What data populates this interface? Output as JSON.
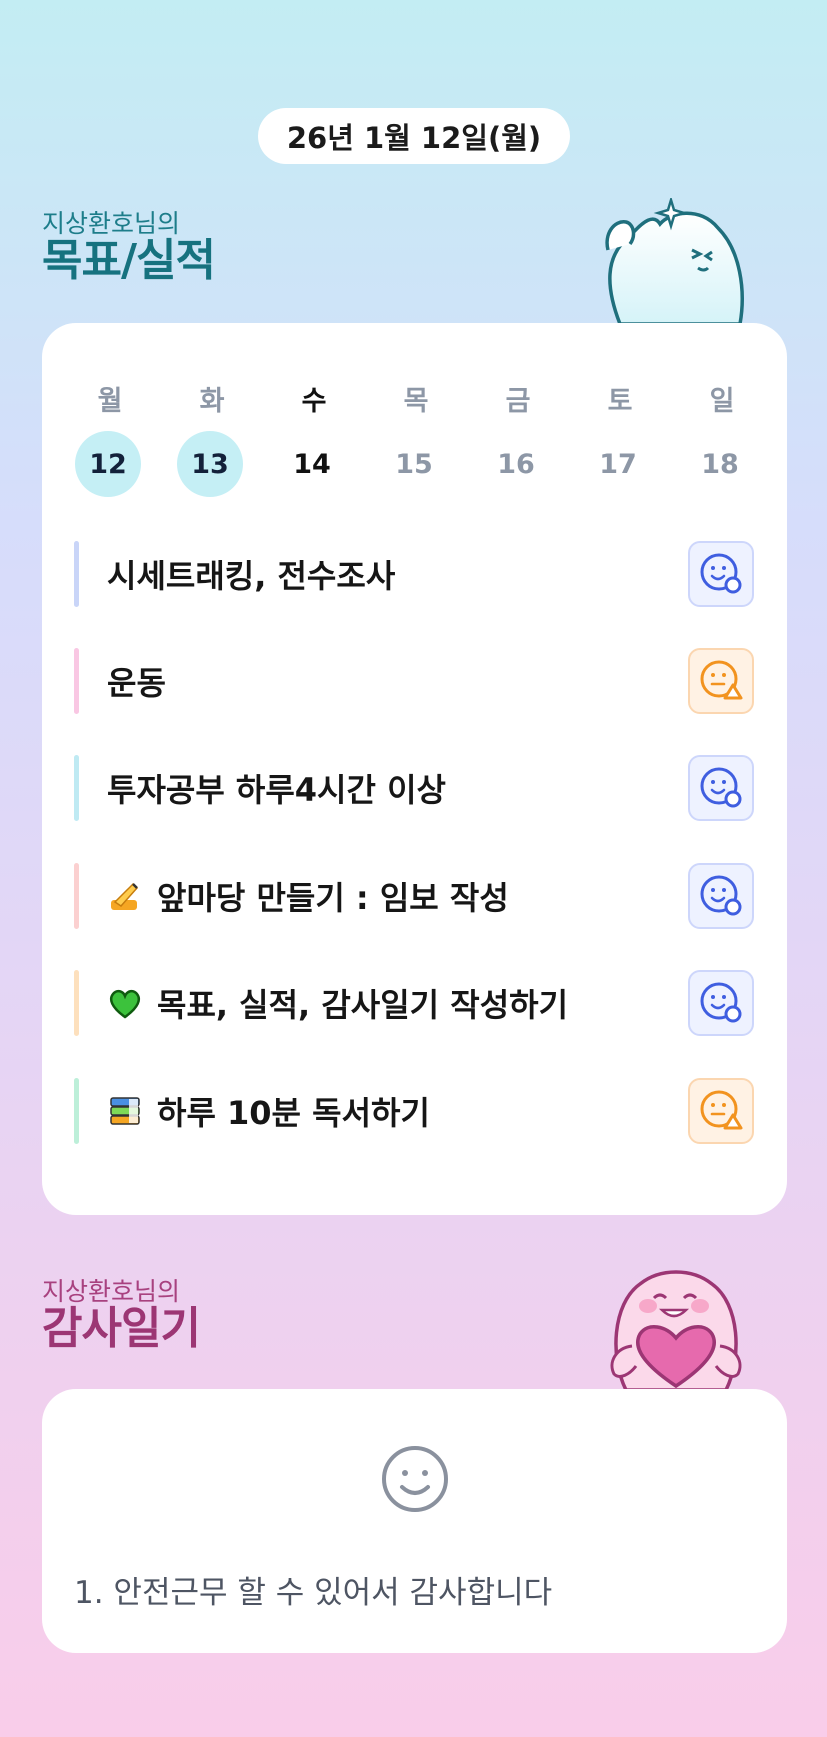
{
  "header": {
    "date": "26년 1월 12일(월)"
  },
  "goals_section": {
    "owner": "지상환호님의",
    "title": "목표/실적"
  },
  "week": {
    "days": [
      {
        "dow": "월",
        "num": "12",
        "state": "done"
      },
      {
        "dow": "화",
        "num": "13",
        "state": "done"
      },
      {
        "dow": "수",
        "num": "14",
        "state": "today"
      },
      {
        "dow": "목",
        "num": "15",
        "state": "future"
      },
      {
        "dow": "금",
        "num": "16",
        "state": "future"
      },
      {
        "dow": "토",
        "num": "17",
        "state": "future"
      },
      {
        "dow": "일",
        "num": "18",
        "state": "future"
      }
    ]
  },
  "goals": [
    {
      "label": "시세트래킹, 전수조사",
      "emoji": "",
      "bar_color": "#c9d5f8",
      "status": "good-icon"
    },
    {
      "label": "운동",
      "emoji": "",
      "bar_color": "#f9c7e3",
      "status": "mid-icon"
    },
    {
      "label": "투자공부 하루4시간 이상",
      "emoji": "",
      "bar_color": "#bfeaf3",
      "status": "good-icon"
    },
    {
      "label": "앞마당 만들기 : 임보 작성",
      "emoji": "writing-hand-icon",
      "bar_color": "#fbd0d0",
      "status": "good-icon"
    },
    {
      "label": "목표, 실적, 감사일기 작성하기",
      "emoji": "green-heart-icon",
      "bar_color": "#fde0bd",
      "status": "good-icon"
    },
    {
      "label": "하루 10분 독서하기",
      "emoji": "books-icon",
      "bar_color": "#bdefd9",
      "status": "mid-icon"
    }
  ],
  "gratitude_section": {
    "owner": "지상환호님의",
    "title": "감사일기"
  },
  "gratitude": {
    "entry": "1. 안전근무 할 수 있어서 감사합니다"
  },
  "colors": {
    "good": "#3f5ee0",
    "mid": "#f2931f",
    "goals_title": "#16727f",
    "gratitude_title": "#9c3674"
  }
}
